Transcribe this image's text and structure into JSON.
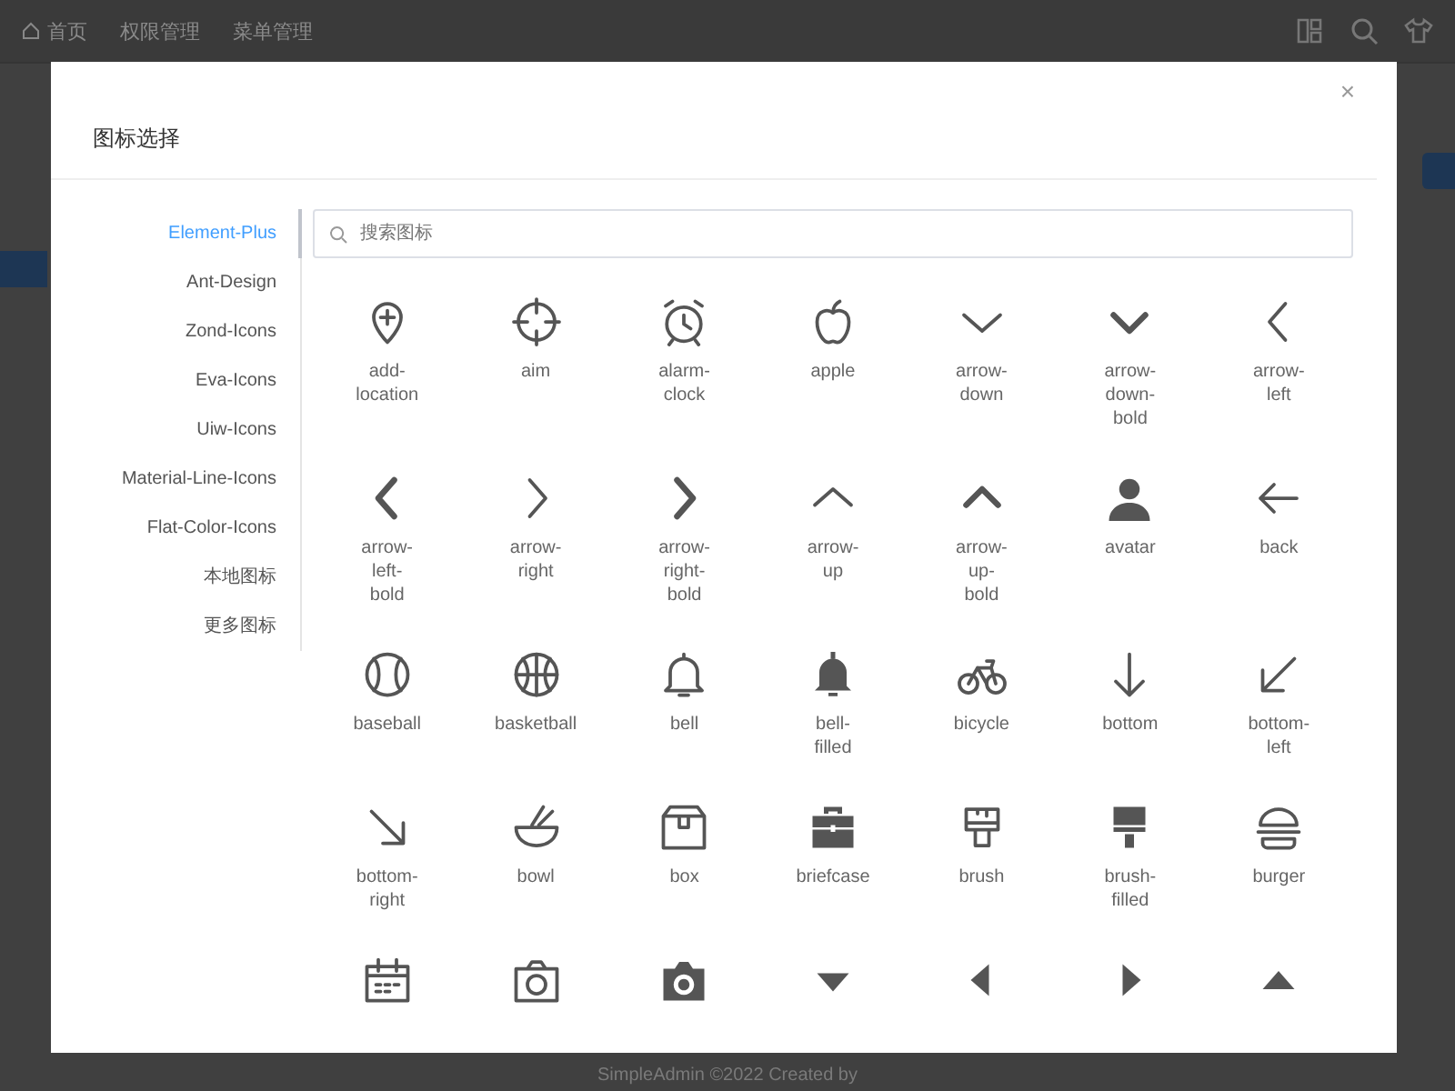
{
  "header": {
    "breadcrumbs": [
      "首页",
      "权限管理",
      "菜单管理"
    ]
  },
  "dialog": {
    "title": "图标选择",
    "close": "×",
    "search": {
      "placeholder": "搜索图标"
    },
    "libraries": [
      {
        "label": "Element-Plus",
        "selected": true
      },
      {
        "label": "Ant-Design",
        "selected": false
      },
      {
        "label": "Zond-Icons",
        "selected": false
      },
      {
        "label": "Eva-Icons",
        "selected": false
      },
      {
        "label": "Uiw-Icons",
        "selected": false
      },
      {
        "label": "Material-Line-Icons",
        "selected": false
      },
      {
        "label": "Flat-Color-Icons",
        "selected": false
      },
      {
        "label": "本地图标",
        "selected": false
      },
      {
        "label": "更多图标",
        "selected": false
      }
    ],
    "icons": [
      {
        "kind": "labeled",
        "label": "add-location"
      },
      {
        "kind": "labeled",
        "label": "aim"
      },
      {
        "kind": "labeled",
        "label": "alarm-clock"
      },
      {
        "kind": "labeled",
        "label": "apple"
      },
      {
        "kind": "labeled",
        "label": "arrow-down"
      },
      {
        "kind": "labeled",
        "label": "arrow-down-bold"
      },
      {
        "kind": "labeled",
        "label": "arrow-left"
      },
      {
        "kind": "labeled",
        "label": "arrow-left-bold"
      },
      {
        "kind": "labeled",
        "label": "arrow-right"
      },
      {
        "kind": "labeled",
        "label": "arrow-right-bold"
      },
      {
        "kind": "labeled",
        "label": "arrow-up"
      },
      {
        "kind": "labeled",
        "label": "arrow-up-bold"
      },
      {
        "kind": "labeled",
        "label": "avatar"
      },
      {
        "kind": "labeled",
        "label": "back"
      },
      {
        "kind": "labeled",
        "label": "baseball"
      },
      {
        "kind": "labeled",
        "label": "basketball"
      },
      {
        "kind": "labeled",
        "label": "bell"
      },
      {
        "kind": "labeled",
        "label": "bell-filled"
      },
      {
        "kind": "labeled",
        "label": "bicycle"
      },
      {
        "kind": "labeled",
        "label": "bottom"
      },
      {
        "kind": "labeled",
        "label": "bottom-left"
      },
      {
        "kind": "labeled",
        "label": "bottom-right"
      },
      {
        "kind": "labeled",
        "label": "bowl"
      },
      {
        "kind": "labeled",
        "label": "box"
      },
      {
        "kind": "labeled",
        "label": "briefcase"
      },
      {
        "kind": "labeled",
        "label": "brush"
      },
      {
        "kind": "labeled",
        "label": "brush-filled"
      },
      {
        "kind": "labeled",
        "label": "burger"
      },
      {
        "kind": "unlabeled"
      },
      {
        "kind": "unlabeled"
      },
      {
        "kind": "unlabeled"
      },
      {
        "kind": "unlabeled"
      },
      {
        "kind": "unlabeled"
      },
      {
        "kind": "unlabeled"
      },
      {
        "kind": "unlabeled"
      }
    ]
  },
  "footer": "SimpleAdmin ©2022 Created by"
}
